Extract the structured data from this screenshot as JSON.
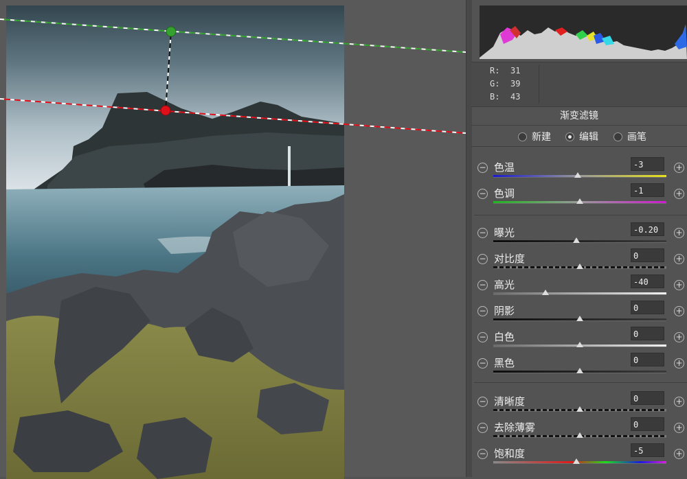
{
  "histogram": {
    "label": "histogram"
  },
  "readout": {
    "rows": [
      {
        "channel": "R:",
        "value": "31"
      },
      {
        "channel": "G:",
        "value": "39"
      },
      {
        "channel": "B:",
        "value": "43"
      }
    ]
  },
  "panel": {
    "title": "渐变滤镜",
    "modes": [
      {
        "label": "新建",
        "selected": false
      },
      {
        "label": "编辑",
        "selected": true
      },
      {
        "label": "画笔",
        "selected": false
      }
    ]
  },
  "sliders": [
    {
      "key": "temp",
      "label": "色温",
      "value": "-3",
      "track": "temp",
      "position": 0.49
    },
    {
      "key": "tint",
      "label": "色调",
      "value": "-1",
      "track": "tint",
      "position": 0.5
    },
    {
      "key": "exposure",
      "label": "曝光",
      "value": "-0.20",
      "track": "dark",
      "position": 0.48
    },
    {
      "key": "contrast",
      "label": "对比度",
      "value": "0",
      "track": "dashed",
      "position": 0.5
    },
    {
      "key": "highlights",
      "label": "高光",
      "value": "-40",
      "track": "light",
      "position": 0.3
    },
    {
      "key": "shadows",
      "label": "阴影",
      "value": "0",
      "track": "dark",
      "position": 0.5
    },
    {
      "key": "whites",
      "label": "白色",
      "value": "0",
      "track": "light",
      "position": 0.5
    },
    {
      "key": "blacks",
      "label": "黑色",
      "value": "0",
      "track": "dark",
      "position": 0.5
    },
    {
      "key": "clarity",
      "label": "清晰度",
      "value": "0",
      "track": "dashed",
      "position": 0.5
    },
    {
      "key": "dehaze",
      "label": "去除薄雾",
      "value": "0",
      "track": "dashed",
      "position": 0.5
    },
    {
      "key": "saturation",
      "label": "饱和度",
      "value": "-5",
      "track": "sat",
      "position": 0.48
    }
  ],
  "colors": {
    "green_pin": "#35a12f",
    "red_pin": "#e0101a",
    "panel_bg": "#535353"
  },
  "icons": {
    "minus": "minus-circle-icon",
    "plus": "plus-circle-icon"
  }
}
